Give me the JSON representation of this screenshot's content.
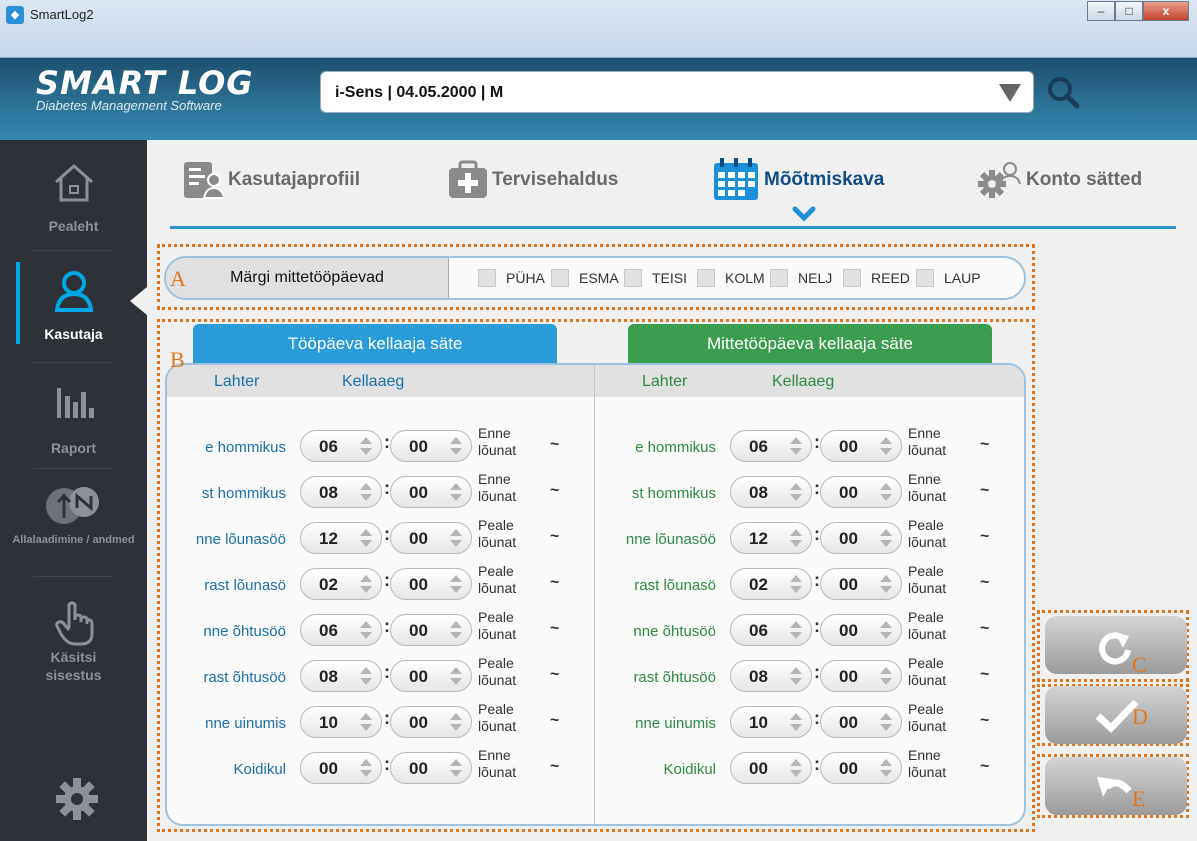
{
  "window": {
    "title": "SmartLog2",
    "min": "–",
    "max": "□",
    "close": "x"
  },
  "header": {
    "logo": "SMART LOG",
    "logo_sub": "Diabetes Management Software",
    "patient": "i-Sens | 04.05.2000 | M"
  },
  "sidebar": {
    "items": [
      {
        "label": "Pealeht"
      },
      {
        "label": "Kasutaja"
      },
      {
        "label": "Raport"
      },
      {
        "label": "Allalaadimine / andmed"
      },
      {
        "label": "Käsitsi sisestus"
      }
    ]
  },
  "tabs": [
    "Kasutajaprofiil",
    "Tervisehaldus",
    "Mõõtmiskava",
    "Konto sätted"
  ],
  "nonworkdays": {
    "label": "Märgi mittetööpäevad",
    "days": [
      "PÜHA",
      "ESMA",
      "TEISI",
      "KOLM",
      "NELJ",
      "REED",
      "LAUP"
    ]
  },
  "annotations": {
    "a": "A",
    "b": "B",
    "c": "C",
    "d": "D",
    "e": "E"
  },
  "workday": {
    "title": "Tööpäeva kellaaja säte",
    "col_slot": "Lahter",
    "col_time": "Kellaaeg"
  },
  "offday": {
    "title": "Mittetööpäeva kellaaja säte",
    "col_slot": "Lahter",
    "col_time": "Kellaaeg"
  },
  "rows": [
    {
      "label": "e hommikus",
      "h": "06",
      "m": "00",
      "ap1": "Enne",
      "ap2": "lõunat",
      "t": "~"
    },
    {
      "label": "st hommikus",
      "h": "08",
      "m": "00",
      "ap1": "Enne",
      "ap2": "lõunat",
      "t": "~"
    },
    {
      "label": "nne lõunasöö",
      "h": "12",
      "m": "00",
      "ap1": "Peale",
      "ap2": "lõunat",
      "t": "~"
    },
    {
      "label": "rast lõunasö",
      "h": "02",
      "m": "00",
      "ap1": "Peale",
      "ap2": "lõunat",
      "t": "~"
    },
    {
      "label": "nne õhtusöö",
      "h": "06",
      "m": "00",
      "ap1": "Peale",
      "ap2": "lõunat",
      "t": "~"
    },
    {
      "label": "rast õhtusöö",
      "h": "08",
      "m": "00",
      "ap1": "Peale",
      "ap2": "lõunat",
      "t": "~"
    },
    {
      "label": "nne uinumis",
      "h": "10",
      "m": "00",
      "ap1": "Peale",
      "ap2": "lõunat",
      "t": "~"
    },
    {
      "label": "Koidikul",
      "h": "00",
      "m": "00",
      "ap1": "Enne",
      "ap2": "lõunat",
      "t": "~"
    }
  ],
  "colors": {
    "accent": "#2a9bd9",
    "work": "#2a9bd9",
    "off": "#3a9d4e",
    "orange": "#e0751b"
  },
  "colon": ":"
}
